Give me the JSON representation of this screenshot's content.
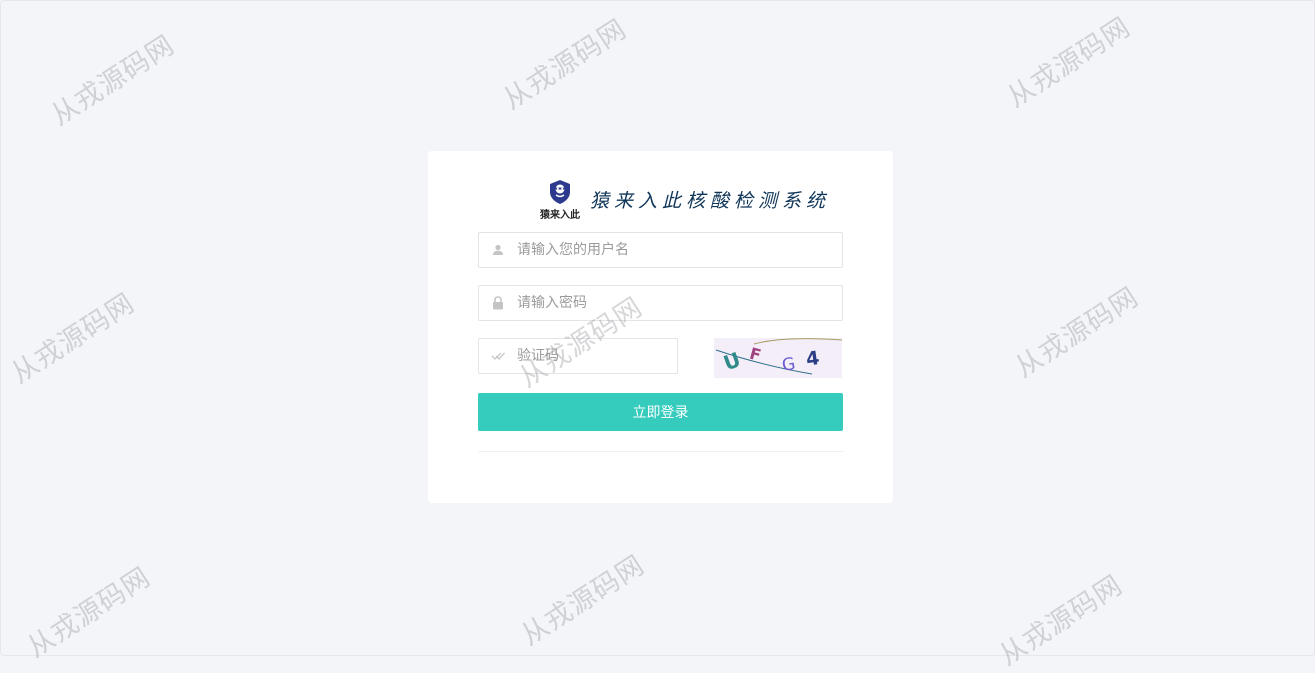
{
  "brand": {
    "logo_text": "猿来入此",
    "title": "猿来入此核酸检测系统"
  },
  "form": {
    "username": {
      "placeholder": "请输入您的用户名",
      "value": "",
      "icon": "user-icon"
    },
    "password": {
      "placeholder": "请输入密码",
      "value": "",
      "icon": "lock-icon"
    },
    "captcha": {
      "placeholder": "验证码",
      "value": "",
      "icon": "check-icon",
      "image_text": "UFG4"
    },
    "submit_label": "立即登录"
  },
  "watermark": {
    "text": "从戎源码网"
  },
  "colors": {
    "accent": "#35cbbd",
    "background": "#f4f5f9",
    "brand_title": "#0f3558",
    "logo_blue": "#2b3a8c"
  }
}
